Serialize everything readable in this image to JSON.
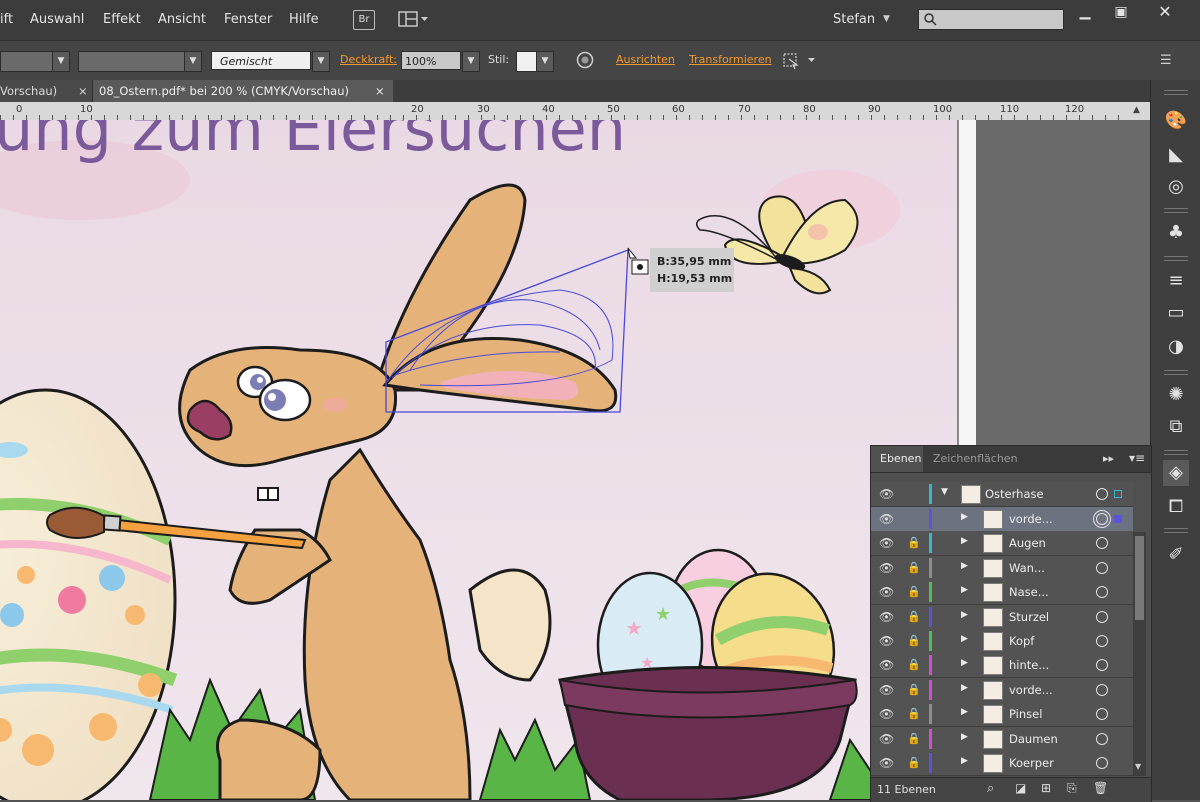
{
  "menubar": {
    "items": [
      "ift",
      "Auswahl",
      "Effekt",
      "Ansicht",
      "Fenster",
      "Hilfe"
    ],
    "bridge_label": "Br",
    "user": "Stefan",
    "user_arrow": "▸"
  },
  "controlbar": {
    "style_value": "Gemischt",
    "opacity_label": "Deckkraft:",
    "opacity_value": "100%",
    "stil_label": "Stil:",
    "align_link": "Ausrichten",
    "transform_link": "Transformieren"
  },
  "tabs": [
    {
      "label": "Vorschau)"
    },
    {
      "label": "08_Ostern.pdf* bei 200 % (CMYK/Vorschau)"
    }
  ],
  "tab_close": "×",
  "ruler": {
    "labels": [
      "0",
      "10",
      "20",
      "30",
      "40",
      "50",
      "60",
      "70",
      "80",
      "90",
      "100",
      "110",
      "120"
    ]
  },
  "artwork": {
    "headline": "ung zum Eiersuchen",
    "tooltip_w": "B:35,95 mm",
    "tooltip_h": "H:19,53 mm"
  },
  "layers_panel": {
    "tab_layers": "Ebenen",
    "tab_artboards": "Zeichenflächen",
    "top_layer": "Osterhase",
    "rows": [
      {
        "name": "vorde...",
        "color": "#5a55d8",
        "locked": false,
        "selected": true
      },
      {
        "name": "Augen",
        "color": "#36b8d2",
        "locked": true,
        "selected": false
      },
      {
        "name": "Wan...",
        "color": "#8e8e8e",
        "locked": true,
        "selected": false
      },
      {
        "name": "Nase...",
        "color": "#52bb5a",
        "locked": true,
        "selected": false
      },
      {
        "name": "Sturzel",
        "color": "#5a55d8",
        "locked": true,
        "selected": false
      },
      {
        "name": "Kopf",
        "color": "#52bb5a",
        "locked": true,
        "selected": false
      },
      {
        "name": "hinte...",
        "color": "#d04fd0",
        "locked": true,
        "selected": false
      },
      {
        "name": "vorde...",
        "color": "#d04fd0",
        "locked": true,
        "selected": false
      },
      {
        "name": "Pinsel",
        "color": "#8e8e8e",
        "locked": true,
        "selected": false
      },
      {
        "name": "Daumen",
        "color": "#d04fd0",
        "locked": true,
        "selected": false
      },
      {
        "name": "Koerper",
        "color": "#5a55d8",
        "locked": true,
        "selected": false
      }
    ],
    "footer_count": "11 Ebenen"
  },
  "icons": {
    "eye": "eye-icon",
    "lock": "lock-icon",
    "disclosure": "triangle-right-icon"
  },
  "colors": {
    "accent_orange": "#f39a2c",
    "canvas_bg": "#ead9e3",
    "selection_blue": "#4a4ad8",
    "headline_purple": "#7a5a9a"
  }
}
